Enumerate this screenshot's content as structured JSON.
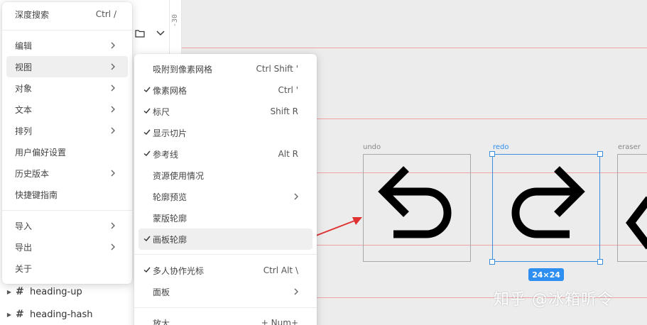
{
  "ruler": {
    "tick": "-30"
  },
  "layers": [
    {
      "name": "heading-up"
    },
    {
      "name": "heading-hash"
    }
  ],
  "main_menu": {
    "items": [
      {
        "label": "深度搜索",
        "shortcut": "Ctrl  /"
      },
      {
        "label": "编辑",
        "submenu": true
      },
      {
        "label": "视图",
        "submenu": true,
        "active": true
      },
      {
        "label": "对象",
        "submenu": true
      },
      {
        "label": "文本",
        "submenu": true
      },
      {
        "label": "排列",
        "submenu": true
      },
      {
        "label": "用户偏好设置"
      },
      {
        "label": "历史版本",
        "submenu": true
      },
      {
        "label": "快捷键指南"
      },
      {
        "label": "导入",
        "submenu": true
      },
      {
        "label": "导出",
        "submenu": true
      },
      {
        "label": "关于"
      }
    ]
  },
  "view_submenu": {
    "items": [
      {
        "label": "吸附到像素网格",
        "shortcut": "Ctrl Shift  '",
        "checked": false
      },
      {
        "label": "像素网格",
        "shortcut": "Ctrl  '",
        "checked": true
      },
      {
        "label": "标尺",
        "shortcut": "Shift R",
        "checked": true
      },
      {
        "label": "显示切片",
        "shortcut": "",
        "checked": true
      },
      {
        "label": "参考线",
        "shortcut": "Alt R",
        "checked": true
      },
      {
        "label": "资源使用情况",
        "shortcut": "",
        "checked": false
      },
      {
        "label": "轮廓预览",
        "shortcut": "",
        "checked": false,
        "submenu": true
      },
      {
        "label": "蒙版轮廓",
        "shortcut": "",
        "checked": false
      },
      {
        "label": "画板轮廓",
        "shortcut": "",
        "checked": true,
        "active": true
      },
      {
        "label": "多人协作光标",
        "shortcut": "Ctrl Alt  \\",
        "checked": true
      },
      {
        "label": "面板",
        "shortcut": "",
        "checked": false,
        "submenu": true
      },
      {
        "label": "放大",
        "shortcut": "+  Num+",
        "checked": false
      }
    ]
  },
  "frames": {
    "undo": {
      "label": "undo",
      "icon": "undo-icon"
    },
    "redo": {
      "label": "redo",
      "icon": "redo-icon",
      "size": "24×24"
    },
    "eraser": {
      "label": "eraser",
      "icon": "eraser-icon"
    }
  },
  "colors": {
    "selection": "#2f8ff0",
    "guide": "#f0a3a3",
    "annotation_arrow": "#e03131"
  },
  "watermark": "知乎 @冰箱听令"
}
